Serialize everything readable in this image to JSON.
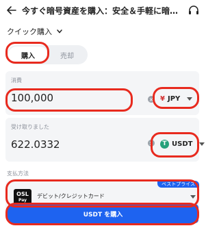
{
  "header": {
    "title": "今すぐ暗号資産を購入：安全＆手軽に暗号...",
    "back_icon": "arrow-left-icon",
    "support_icon": "headset-icon"
  },
  "mode": {
    "label": "クイック購入"
  },
  "tabs": [
    {
      "label": "購入",
      "active": true
    },
    {
      "label": "売却",
      "active": false
    }
  ],
  "spend": {
    "label": "消費",
    "value": "100,000",
    "currency": "JPY",
    "currency_symbol": "¥"
  },
  "receive": {
    "label": "受け取りました",
    "value": "622.0332",
    "currency": "USDT",
    "currency_symbol": "T"
  },
  "payment": {
    "label": "支払方法",
    "badge": "ベストプライス",
    "logo_top": "OSL",
    "logo_bottom": "Pay",
    "method": "デビット/クレジットカード"
  },
  "buy_button": {
    "label": "USDT を購入"
  },
  "colors": {
    "accent": "#1e63f0",
    "highlight": "#e82a1e",
    "tether": "#26a17b",
    "yen": "#d32f2f"
  }
}
